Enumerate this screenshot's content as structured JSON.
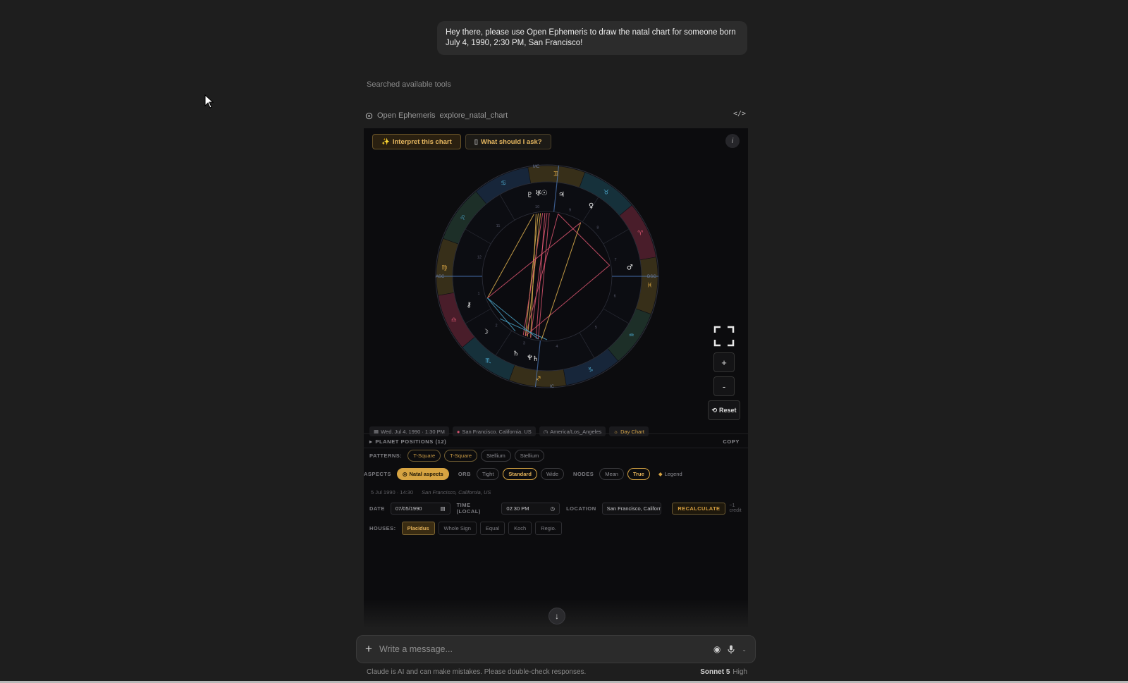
{
  "user_message": "Hey there, please use Open Ephemeris to draw the natal chart for someone born July 4, 1990, 2:30 PM, San Francisco!",
  "tools_status": "Searched available tools",
  "tool_call": {
    "app": "Open Ephemeris",
    "function": "explore_natal_chart",
    "code_icon": "</>"
  },
  "widget": {
    "interpret_label": "Interpret this chart",
    "ask_label": "What should I ask?",
    "info_label": "i",
    "wheel_labels": {
      "asc": "ASC",
      "dsc": "DSC",
      "mc": "MC",
      "ic": "IC"
    },
    "house_numbers": [
      "1",
      "2",
      "3",
      "4",
      "5",
      "6",
      "7",
      "8",
      "9",
      "10",
      "11",
      "12"
    ],
    "zoom": {
      "plus": "+",
      "minus": "-",
      "reset": "Reset"
    },
    "meta": {
      "date": "Wed, Jul 4, 1990 · 1:30 PM",
      "location": "San Francisco, California, US",
      "timezone": "America/Los_Angeles",
      "chart_type": "Day Chart"
    },
    "planet_positions_label": "PLANET POSITIONS (12)",
    "copy_label": "COPY",
    "patterns_label": "PATTERNS:",
    "patterns": [
      "T-Square",
      "T-Square",
      "Stellium",
      "Stellium"
    ],
    "aspects_label": "ASPECTS",
    "natal_aspects_label": "Natal aspects",
    "orb_label": "ORB",
    "orb_options": [
      "Tight",
      "Standard",
      "Wide"
    ],
    "nodes_label": "NODES",
    "node_options": [
      "Mean",
      "True"
    ],
    "legend_label": "Legend",
    "subline_date": "5 Jul 1990 · 14:30",
    "subline_location": "San Francisco, California, US",
    "date_label": "DATE",
    "date_value": "07/05/1990",
    "time_label": "TIME (LOCAL)",
    "time_value": "02:30 PM",
    "location_label": "LOCATION",
    "location_value": "San Francisco, Californ",
    "recalculate_label": "RECALCULATE",
    "credit_label": "~1 credit",
    "houses_label": "HOUSES:",
    "house_systems": [
      "Placidus",
      "Whole Sign",
      "Equal",
      "Koch",
      "Regio."
    ]
  },
  "composer": {
    "placeholder": "Write a message..."
  },
  "footer": {
    "disclaimer": "Claude is AI and can make mistakes. Please double-check responses.",
    "model": "Sonnet 5",
    "effort": "High"
  },
  "colors": {
    "accent_gold": "#d7a442",
    "aspect_red": "#d9546f",
    "aspect_blue": "#4aa3c7",
    "aspect_gold": "#e0b24f"
  }
}
